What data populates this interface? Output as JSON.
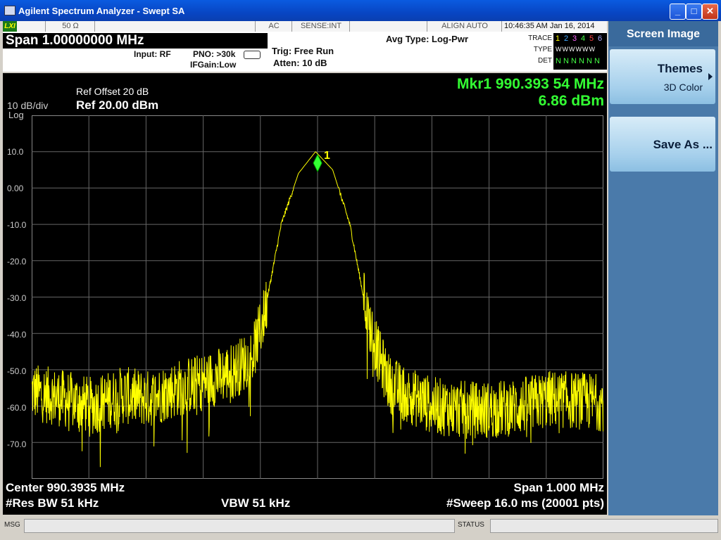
{
  "window": {
    "title": "Agilent Spectrum Analyzer - Swept SA"
  },
  "status_strip": {
    "lxi": "LXI",
    "impedance": "50 Ω",
    "coupling": "AC",
    "sense": "SENSE:INT",
    "align": "ALIGN AUTO",
    "time": "10:46:35 AM",
    "date": "Jan 16, 2014"
  },
  "header": {
    "span_label": "Span  1.00000000 MHz",
    "input": "Input: RF",
    "pno": "PNO: >30k",
    "ifgain": "IFGain:Low",
    "trig": "Trig: Free Run",
    "atten": "Atten: 10 dB",
    "avg_type": "Avg Type: Log-Pwr",
    "trace_label": "TRACE",
    "type_label": "TYPE",
    "det_label": "DET",
    "trace_nums": [
      "1",
      "2",
      "3",
      "4",
      "5",
      "6"
    ],
    "type_row": "WWWWWW",
    "det_row": "N N N N N N"
  },
  "screen": {
    "ref_offset": "Ref Offset 20 dB",
    "scale": "10 dB/div",
    "ref_level": "Ref 20.00 dBm",
    "log": "Log",
    "marker_freq": "Mkr1 990.393 54 MHz",
    "marker_amp": "6.86 dBm",
    "marker_label": "1",
    "center": "Center 990.3935 MHz",
    "span": "Span 1.000 MHz",
    "res_bw": "#Res BW 51 kHz",
    "vbw": "VBW 51 kHz",
    "sweep": "#Sweep  16.0 ms (20001 pts)",
    "y_ticks": [
      "10.0",
      "0.00",
      "-10.0",
      "-20.0",
      "-30.0",
      "-40.0",
      "-50.0",
      "-60.0",
      "-70.0"
    ]
  },
  "chart_data": {
    "type": "line",
    "xlabel": "",
    "ylabel": "",
    "xlim": [
      989.8935,
      990.8935
    ],
    "ylim": [
      -80,
      20
    ],
    "series": [
      {
        "x": [
          989.8935,
          989.95,
          990.0,
          990.05,
          990.1,
          990.15,
          990.2,
          990.25,
          990.28,
          990.3,
          990.33,
          990.36,
          990.39,
          990.42,
          990.45,
          990.48,
          990.5,
          990.52,
          990.55,
          990.6,
          990.65,
          990.7,
          990.75,
          990.8,
          990.8935
        ],
        "values": [
          -56,
          -58,
          -60,
          -57,
          -58,
          -55,
          -53,
          -50,
          -46,
          -35,
          -10,
          4,
          10,
          5,
          -10,
          -35,
          -46,
          -54,
          -57,
          -60,
          -61,
          -61,
          -60,
          -58,
          -59
        ]
      }
    ],
    "marker": {
      "x": 990.39354,
      "y": 6.86
    },
    "grid": true
  },
  "softkeys": {
    "title": "Screen Image",
    "themes": "Themes",
    "themes_sub": "3D Color",
    "save_as": "Save As ..."
  },
  "msgbar": {
    "msg": "MSG",
    "status": "STATUS"
  }
}
